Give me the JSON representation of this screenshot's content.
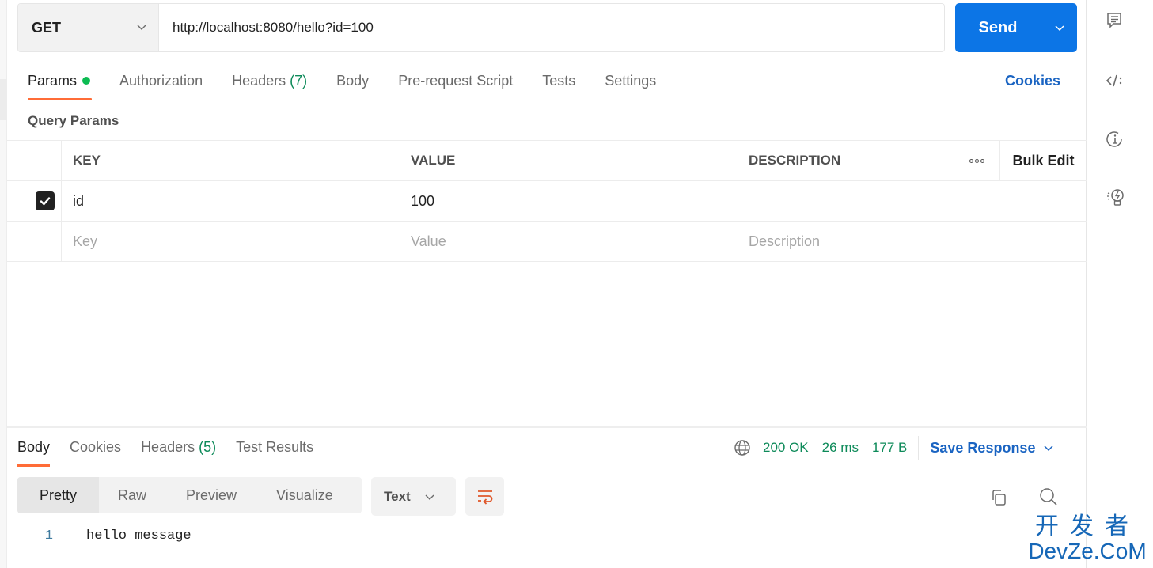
{
  "request": {
    "method": "GET",
    "url": "http://localhost:8080/hello?id=100",
    "send_label": "Send"
  },
  "request_tabs": [
    {
      "label": "Params",
      "active": true,
      "dot": true
    },
    {
      "label": "Authorization"
    },
    {
      "label": "Headers",
      "count": "(7)"
    },
    {
      "label": "Body"
    },
    {
      "label": "Pre-request Script"
    },
    {
      "label": "Tests"
    },
    {
      "label": "Settings"
    }
  ],
  "cookies_label": "Cookies",
  "query_params": {
    "title": "Query Params",
    "columns": {
      "key": "KEY",
      "value": "VALUE",
      "description": "DESCRIPTION",
      "bulk_edit": "Bulk Edit"
    },
    "rows": [
      {
        "checked": true,
        "key": "id",
        "value": "100",
        "description": ""
      }
    ],
    "placeholders": {
      "key": "Key",
      "value": "Value",
      "description": "Description"
    }
  },
  "response": {
    "tabs": [
      {
        "label": "Body",
        "active": true
      },
      {
        "label": "Cookies"
      },
      {
        "label": "Headers",
        "count": "(5)"
      },
      {
        "label": "Test Results"
      }
    ],
    "status": "200 OK",
    "time": "26 ms",
    "size": "177 B",
    "save_label": "Save Response",
    "view_modes": [
      "Pretty",
      "Raw",
      "Preview",
      "Visualize"
    ],
    "active_view": "Pretty",
    "format": "Text",
    "lines": [
      {
        "number": "1",
        "text": "hello message"
      }
    ]
  },
  "right_sidebar": [
    "documentation-icon",
    "code-icon",
    "info-icon",
    "bulb-icon"
  ],
  "watermark": {
    "cn": "开发者",
    "en": "DevZe.CoM"
  },
  "colors": {
    "accent": "#ff6c37",
    "send": "#0c75e6",
    "link": "#1a64c2",
    "success": "#0d8a59"
  }
}
